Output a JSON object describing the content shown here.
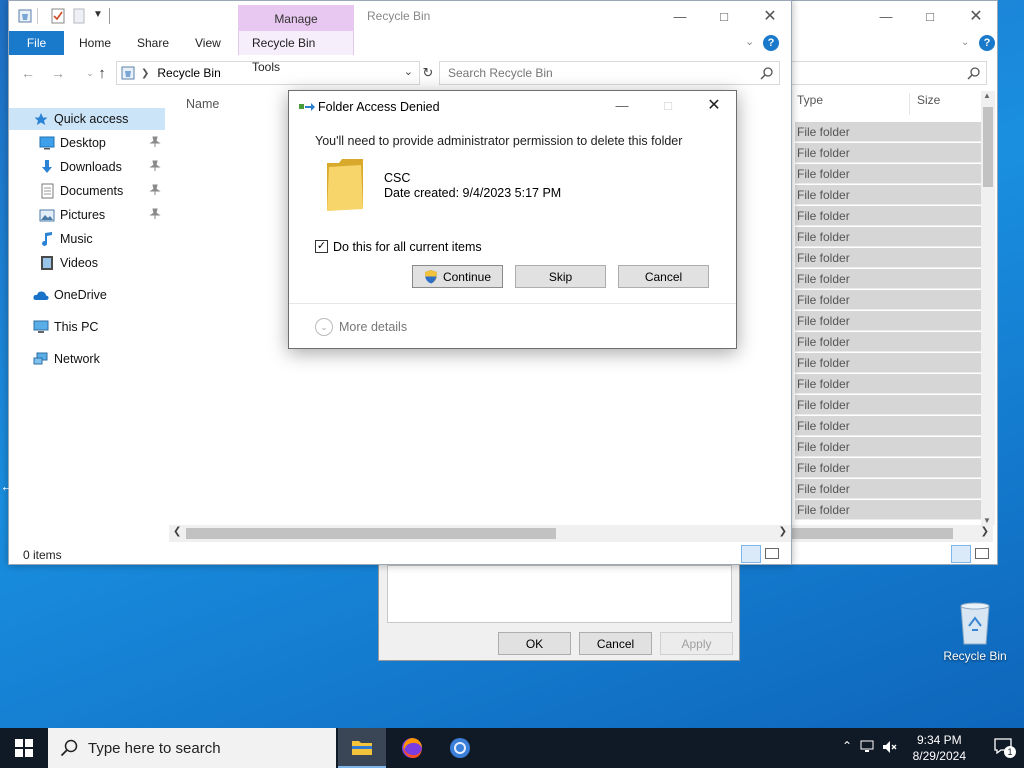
{
  "back_window": {
    "columns": {
      "type": "Type",
      "size": "Size"
    },
    "rows": [
      "File folder",
      "File folder",
      "File folder",
      "File folder",
      "File folder",
      "File folder",
      "File folder",
      "File folder",
      "File folder",
      "File folder",
      "File folder",
      "File folder",
      "File folder",
      "File folder",
      "File folder",
      "File folder",
      "File folder",
      "File folder",
      "File folder"
    ]
  },
  "front_window": {
    "title": "Recycle Bin",
    "manage_tab": "Manage",
    "ribbon_tabs": {
      "file": "File",
      "home": "Home",
      "share": "Share",
      "view": "View",
      "tools": "Recycle Bin Tools"
    },
    "address": "Recycle Bin",
    "search_placeholder": "Search Recycle Bin",
    "column_name": "Name",
    "status": "0 items",
    "nav": {
      "quick_access": "Quick access",
      "items": [
        {
          "label": "Desktop",
          "icon": "desktop-icon",
          "pinned": true
        },
        {
          "label": "Downloads",
          "icon": "downloads-icon",
          "pinned": true
        },
        {
          "label": "Documents",
          "icon": "documents-icon",
          "pinned": true
        },
        {
          "label": "Pictures",
          "icon": "pictures-icon",
          "pinned": true
        },
        {
          "label": "Music",
          "icon": "music-icon",
          "pinned": false
        },
        {
          "label": "Videos",
          "icon": "videos-icon",
          "pinned": false
        }
      ],
      "onedrive": "OneDrive",
      "this_pc": "This PC",
      "network": "Network"
    }
  },
  "dialog": {
    "title": "Folder Access Denied",
    "message": "You'll need to provide administrator permission to delete this folder",
    "item_name": "CSC",
    "item_date": "Date created: 9/4/2023 5:17 PM",
    "checkbox_label": "Do this for all current items",
    "checkbox_checked": true,
    "continue_label": "Continue",
    "skip_label": "Skip",
    "cancel_label": "Cancel",
    "more_details": "More details"
  },
  "properties_dialog": {
    "ok": "OK",
    "cancel": "Cancel",
    "apply": "Apply"
  },
  "desktop": {
    "recycle_bin": "Recycle Bin"
  },
  "taskbar": {
    "search_placeholder": "Type here to search",
    "time": "9:34 PM",
    "date": "8/29/2024",
    "notification_count": "1"
  },
  "colors": {
    "accent": "#1979ca",
    "manage_tab": "#e8c8f0",
    "selected": "#cce4f7"
  }
}
